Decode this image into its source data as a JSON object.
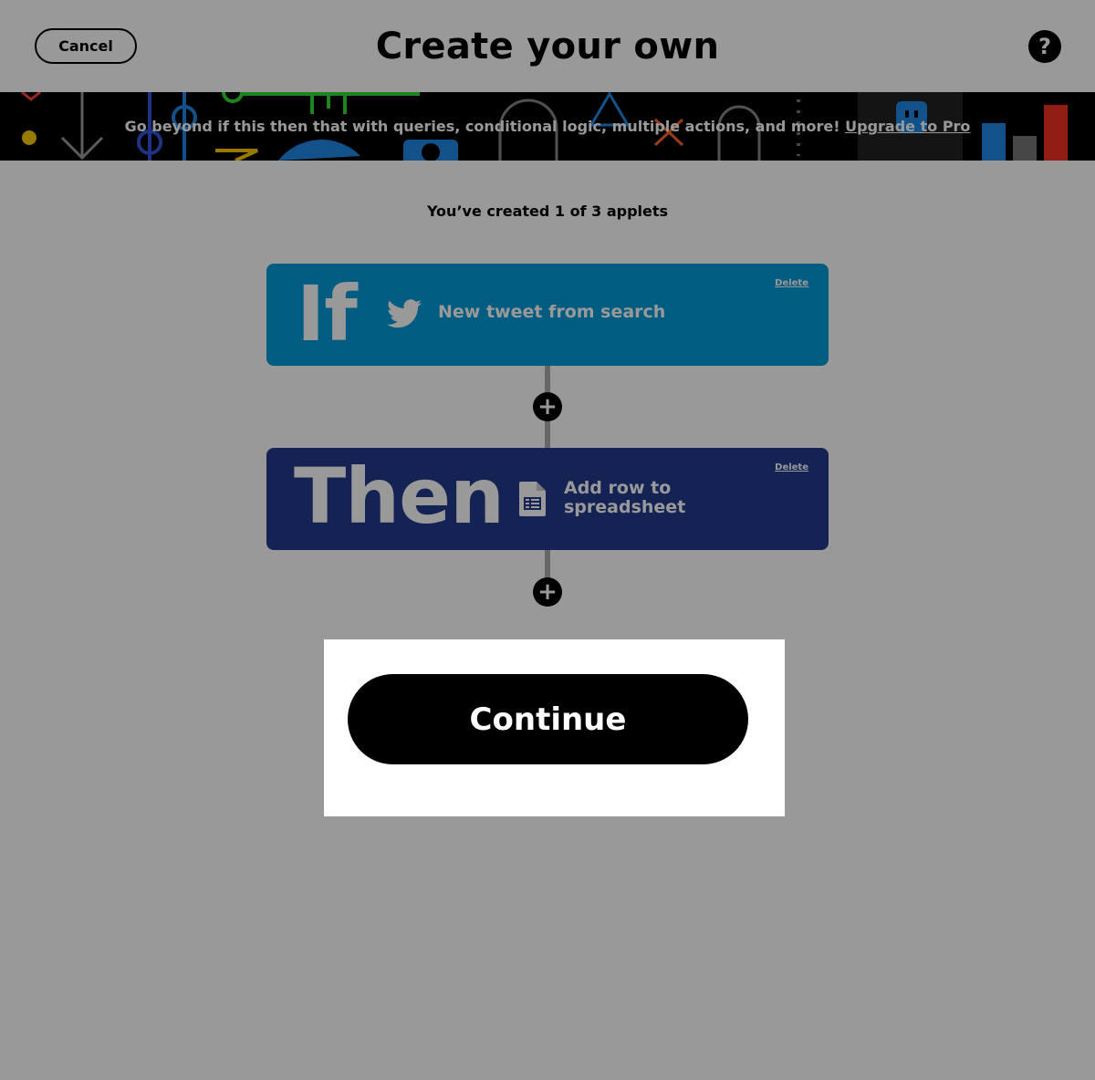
{
  "header": {
    "cancel_label": "Cancel",
    "title": "Create your own",
    "help_label": "?"
  },
  "banner": {
    "text": "Go beyond if this then that with queries, conditional logic, multiple actions, and more! ",
    "link": "Upgrade to Pro"
  },
  "applet_count": "You’ve created 1 of 3 applets",
  "if_card": {
    "keyword": "If",
    "service_icon": "twitter-bird-icon",
    "trigger": "New tweet from search",
    "delete_label": "Delete",
    "color": "#0099d5"
  },
  "then_card": {
    "keyword": "Then",
    "service_icon": "spreadsheet-icon",
    "action_line1": "Add row to",
    "action_line2": "spreadsheet",
    "delete_label": "Delete",
    "color": "#223a8c"
  },
  "add_symbol": "+",
  "continue_label": "Continue"
}
